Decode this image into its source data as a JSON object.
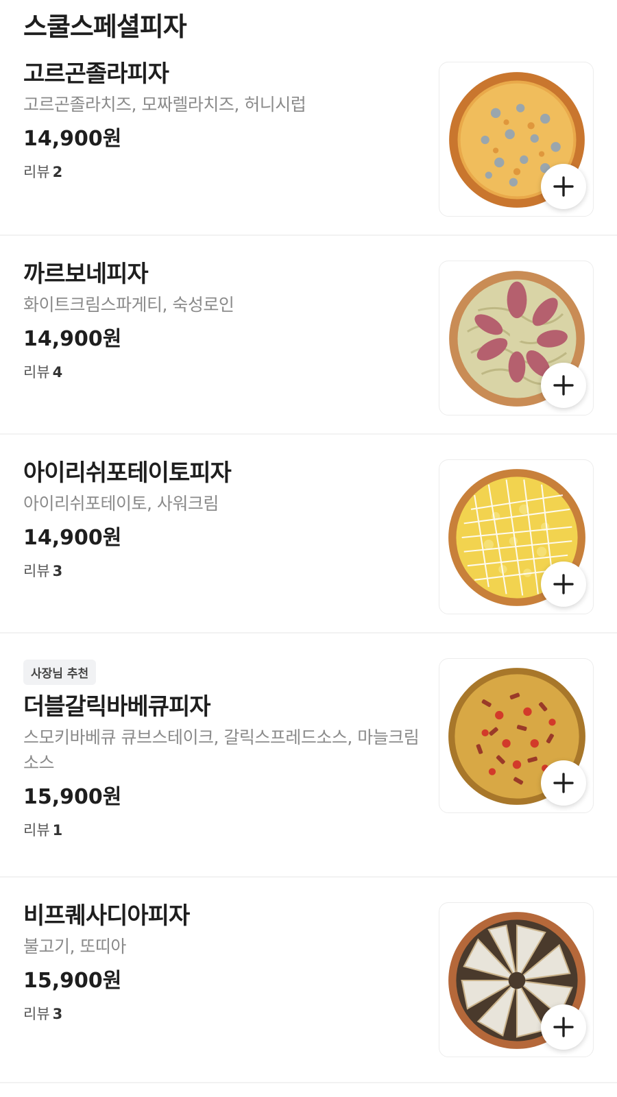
{
  "section": {
    "title": "스쿨스페셜피자"
  },
  "menu": {
    "items": [
      {
        "name": "고르곤졸라피자",
        "description": "고르곤졸라치즈, 모짜렐라치즈, 허니시럽",
        "price": "14,900원",
        "review_label": "리뷰",
        "review_count": "2",
        "badge": "",
        "image_icon": "gorgonzola-pizza-image"
      },
      {
        "name": "까르보네피자",
        "description": "화이트크림스파게티, 숙성로인",
        "price": "14,900원",
        "review_label": "리뷰",
        "review_count": "4",
        "badge": "",
        "image_icon": "carbonara-pizza-image"
      },
      {
        "name": "아이리쉬포테이토피자",
        "description": "아이리쉬포테이토, 사워크림",
        "price": "14,900원",
        "review_label": "리뷰",
        "review_count": "3",
        "badge": "",
        "image_icon": "irish-potato-pizza-image"
      },
      {
        "name": "더블갈릭바베큐피자",
        "description": "스모키바베큐 큐브스테이크, 갈릭스프레드소스, 마늘크림소스",
        "price": "15,900원",
        "review_label": "리뷰",
        "review_count": "1",
        "badge": "사장님 추천",
        "image_icon": "double-garlic-bbq-pizza-image"
      },
      {
        "name": "비프퀘사디아피자",
        "description": "불고기, 또띠아",
        "price": "15,900원",
        "review_label": "리뷰",
        "review_count": "3",
        "badge": "",
        "image_icon": "beef-quesadilla-pizza-image"
      }
    ]
  },
  "icons": {
    "add": "plus-icon"
  },
  "colors": {
    "text_primary": "#1e1e1e",
    "text_secondary": "#8a8a8a",
    "divider": "#f2f2f2",
    "badge_bg": "#f1f2f4"
  }
}
